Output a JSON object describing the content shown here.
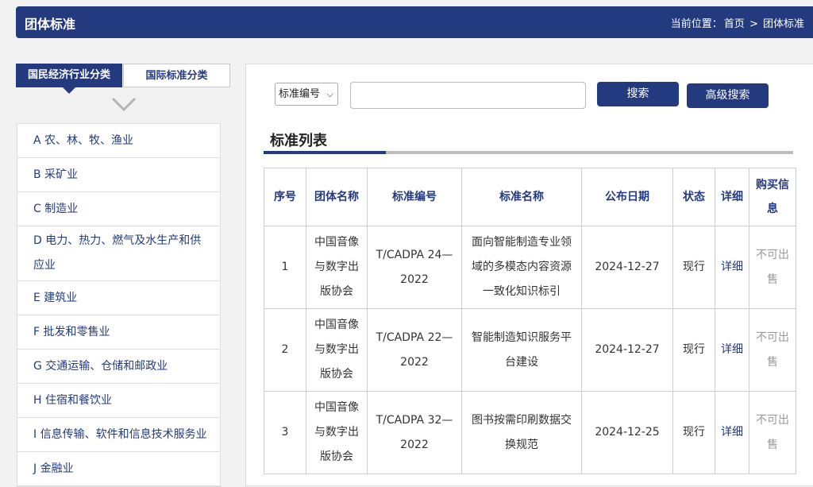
{
  "header": {
    "title": "团体标准",
    "breadcrumb_label": "当前位置：",
    "breadcrumb_home": "首页",
    "breadcrumb_sep": ">",
    "breadcrumb_current": "团体标准"
  },
  "sidebar": {
    "tabs": [
      {
        "label": "国民经济行业分类",
        "active": true
      },
      {
        "label": "国际标准分类",
        "active": false
      }
    ],
    "icons": {
      "expand": "chevron-down-icon"
    },
    "items": [
      {
        "label": "A 农、林、牧、渔业"
      },
      {
        "label": "B 采矿业"
      },
      {
        "label": "C 制造业"
      },
      {
        "label": "D 电力、热力、燃气及水生产和供应业"
      },
      {
        "label": "E 建筑业"
      },
      {
        "label": "F 批发和零售业"
      },
      {
        "label": "G 交通运输、仓储和邮政业"
      },
      {
        "label": "H 住宿和餐饮业"
      },
      {
        "label": "I 信息传输、软件和信息技术服务业"
      },
      {
        "label": "J 金融业"
      }
    ]
  },
  "search": {
    "field_select": "标准编号",
    "query": "",
    "search_label": "搜索",
    "advanced_label": "高级搜索"
  },
  "list": {
    "title": "标准列表",
    "headers": [
      "序号",
      "团体名称",
      "标准编号",
      "标准名称",
      "公布日期",
      "状态",
      "详细",
      "购买信息"
    ],
    "rows": [
      {
        "no": "1",
        "org": "中国音像与数字出版协会",
        "code": "T/CADPA 24—2022",
        "name": "面向智能制造专业领域的多模态内容资源一致化知识标引",
        "date": "2024-12-27",
        "status": "现行",
        "detail": "详细",
        "buy": "不可出售"
      },
      {
        "no": "2",
        "org": "中国音像与数字出版协会",
        "code": "T/CADPA 22—2022",
        "name": "智能制造知识服务平台建设",
        "date": "2024-12-27",
        "status": "现行",
        "detail": "详细",
        "buy": "不可出售"
      },
      {
        "no": "3",
        "org": "中国音像与数字出版协会",
        "code": "T/CADPA 32—2022",
        "name": "图书按需印刷数据交换规范",
        "date": "2024-12-25",
        "status": "现行",
        "detail": "详细",
        "buy": "不可出售"
      }
    ]
  },
  "colors": {
    "brand": "#233a7f",
    "muted": "#999999"
  }
}
